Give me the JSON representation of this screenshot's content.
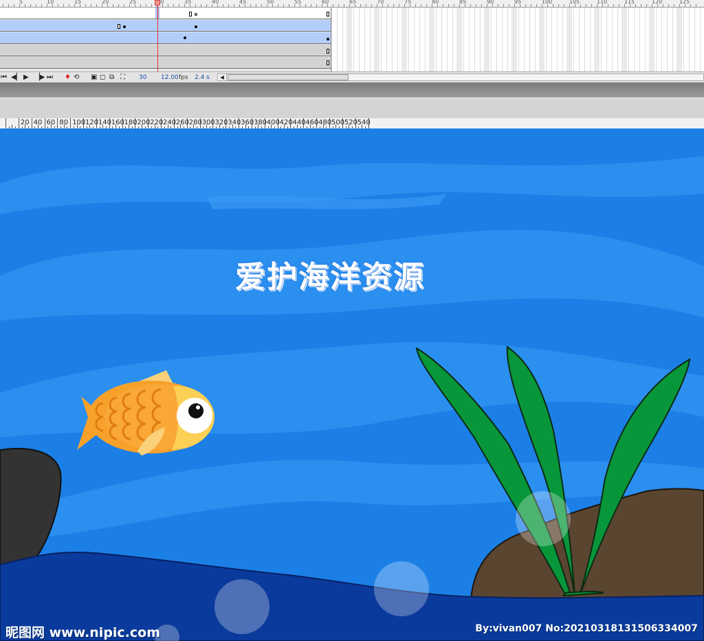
{
  "timeline": {
    "frame_ruler_labels": [
      "5",
      "10",
      "15",
      "20",
      "25",
      "30",
      "35",
      "40",
      "45",
      "50",
      "55",
      "60",
      "65",
      "70",
      "75",
      "80",
      "85",
      "90",
      "95",
      "100",
      "105",
      "110",
      "115",
      "120",
      "125"
    ],
    "controls": {
      "current_frame": "30",
      "frame_rate": "12.00",
      "frame_rate_unit": "fps",
      "elapsed_time": "2.4 s"
    }
  },
  "stage_ruler_labels": [
    "20",
    "40",
    "60",
    "80",
    "100",
    "120",
    "140",
    "160",
    "180",
    "200",
    "220",
    "240",
    "260",
    "280",
    "300",
    "320",
    "340",
    "360",
    "380",
    "400",
    "420",
    "440",
    "460",
    "480",
    "500",
    "520",
    "540"
  ],
  "stage": {
    "title": "爱护海洋资源",
    "watermark_left": "昵图网 www.nipic.com",
    "watermark_right": "By:vivan007 No:20210318131506334007"
  },
  "colors": {
    "sea": "#1b7fe6",
    "sea_deep": "#0a3a9c",
    "weed": "#08963a",
    "rock_brown": "#5a4530",
    "rock_dark": "#333333",
    "fish": "#f7a12b",
    "layer_selected": "#b4cefa"
  },
  "icons": [
    "first-frame-icon",
    "step-back-icon",
    "play-icon",
    "step-forward-icon",
    "last-frame-icon",
    "center-frame-icon",
    "loop-icon",
    "onion-skin-icon",
    "onion-outline-icon",
    "edit-multiple-icon",
    "onion-markers-icon"
  ]
}
